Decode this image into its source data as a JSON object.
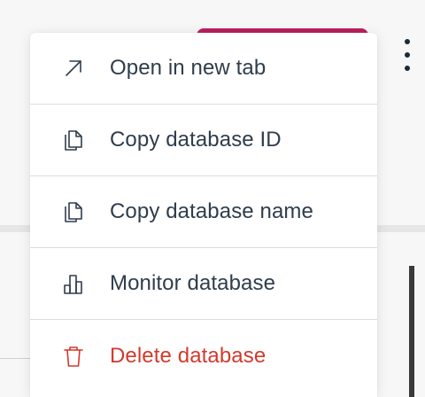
{
  "menu": {
    "items": [
      {
        "label": "Open in new tab",
        "icon": "external-link-icon"
      },
      {
        "label": "Copy database ID",
        "icon": "copy-icon"
      },
      {
        "label": "Copy database name",
        "icon": "copy-icon"
      },
      {
        "label": "Monitor database",
        "icon": "bar-chart-icon"
      },
      {
        "label": "Delete database",
        "icon": "trash-icon"
      }
    ]
  },
  "colors": {
    "text": "#2f3d4c",
    "danger": "#d33a2c",
    "accent_bar": "#bb1f5e",
    "divider": "#d9dde1"
  }
}
